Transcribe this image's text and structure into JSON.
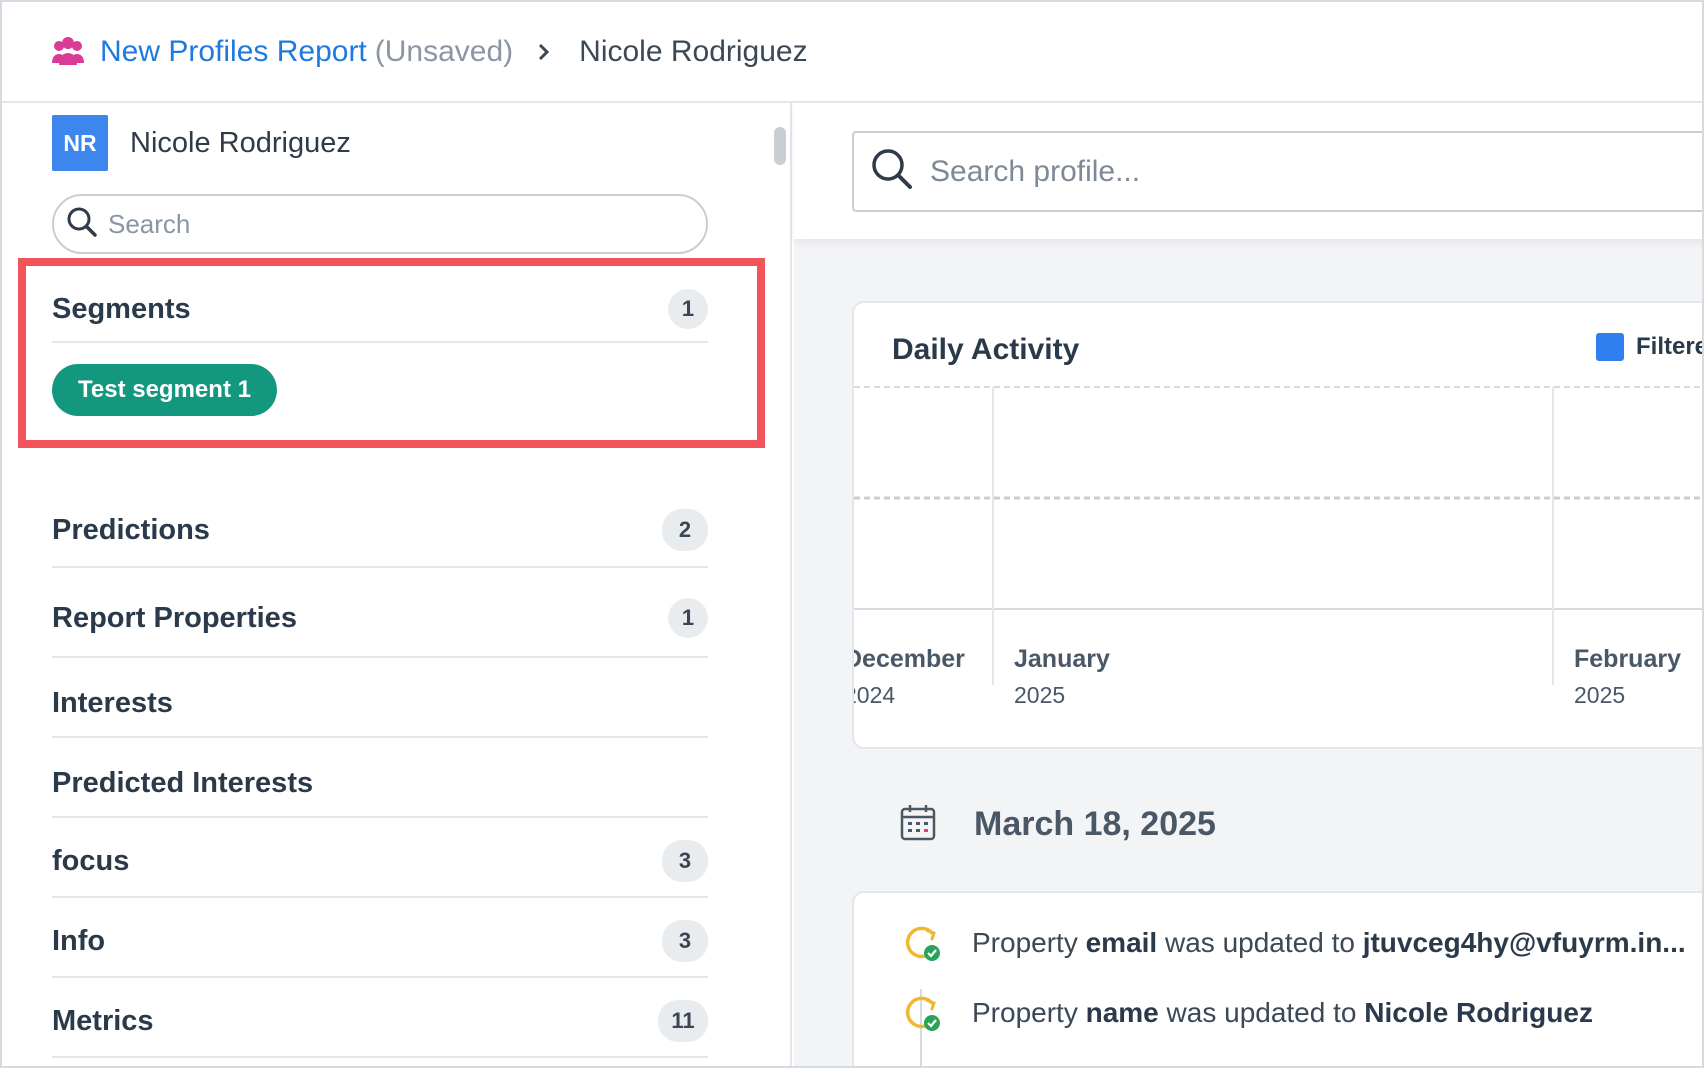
{
  "header": {
    "report_title": "New Profiles Report",
    "unsaved": "(Unsaved)",
    "breadcrumb_current": "Nicole Rodriguez"
  },
  "sidebar": {
    "avatar_initials": "NR",
    "profile_name": "Nicole Rodriguez",
    "search_placeholder": "Search",
    "segments": {
      "label": "Segments",
      "count": "1",
      "pill": "Test segment 1"
    },
    "sections": [
      {
        "label": "Predictions",
        "count": "2"
      },
      {
        "label": "Report Properties",
        "count": "1"
      },
      {
        "label": "Interests",
        "count": ""
      },
      {
        "label": "Predicted Interests",
        "count": ""
      },
      {
        "label": "focus",
        "count": "3"
      },
      {
        "label": "Info",
        "count": "3"
      },
      {
        "label": "Metrics",
        "count": "11"
      }
    ]
  },
  "main": {
    "search_placeholder": "Search profile...",
    "activity": {
      "title": "Daily Activity",
      "legend": "Filtere",
      "months": [
        {
          "name": "December",
          "year": "2024"
        },
        {
          "name": "January",
          "year": "2025"
        },
        {
          "name": "February",
          "year": "2025"
        }
      ]
    },
    "date_heading": "March 18, 2025",
    "events": [
      {
        "prefix": "Property ",
        "property": "email",
        "middle": " was updated to ",
        "value": "jtuvceg4hy@vfuyrm.in..."
      },
      {
        "prefix": "Property ",
        "property": "name",
        "middle": " was updated to ",
        "value": "Nicole Rodriguez"
      }
    ]
  },
  "colors": {
    "accent": "#1f7ae0",
    "highlight": "#f2545b",
    "segment": "#13977f",
    "legend": "#2f7ff0"
  }
}
